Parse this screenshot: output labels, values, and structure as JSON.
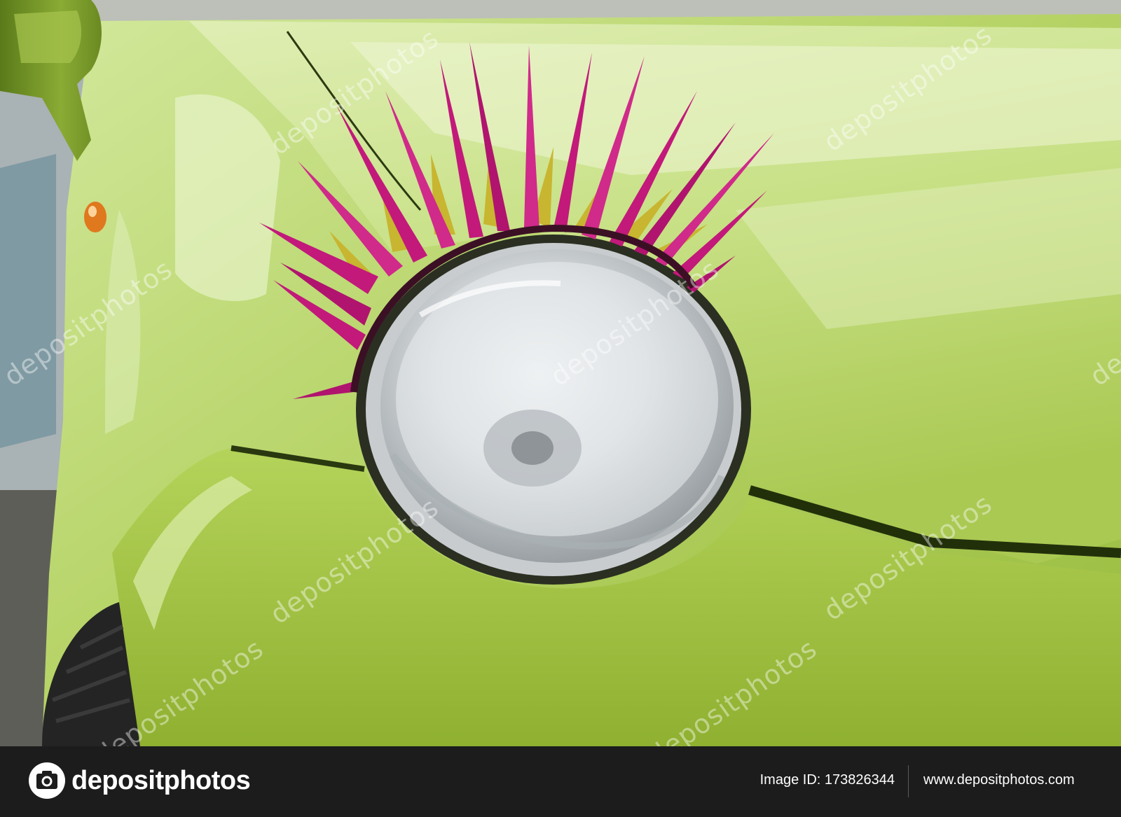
{
  "photo": {
    "subject": "car-headlight-with-eyelashes",
    "colors": {
      "car_body": "#9fc24a",
      "eyelash_pink": "#c2197a",
      "eyelash_gold": "#c8b530",
      "headlight": "#dfe3e6",
      "tire": "#222222"
    },
    "watermark_text": "depositphotos"
  },
  "footer": {
    "brand_name": "depositphotos",
    "image_id_text": "Image ID: 173826344",
    "site_url": "www.depositphotos.com",
    "background": "#1c1c1c"
  }
}
